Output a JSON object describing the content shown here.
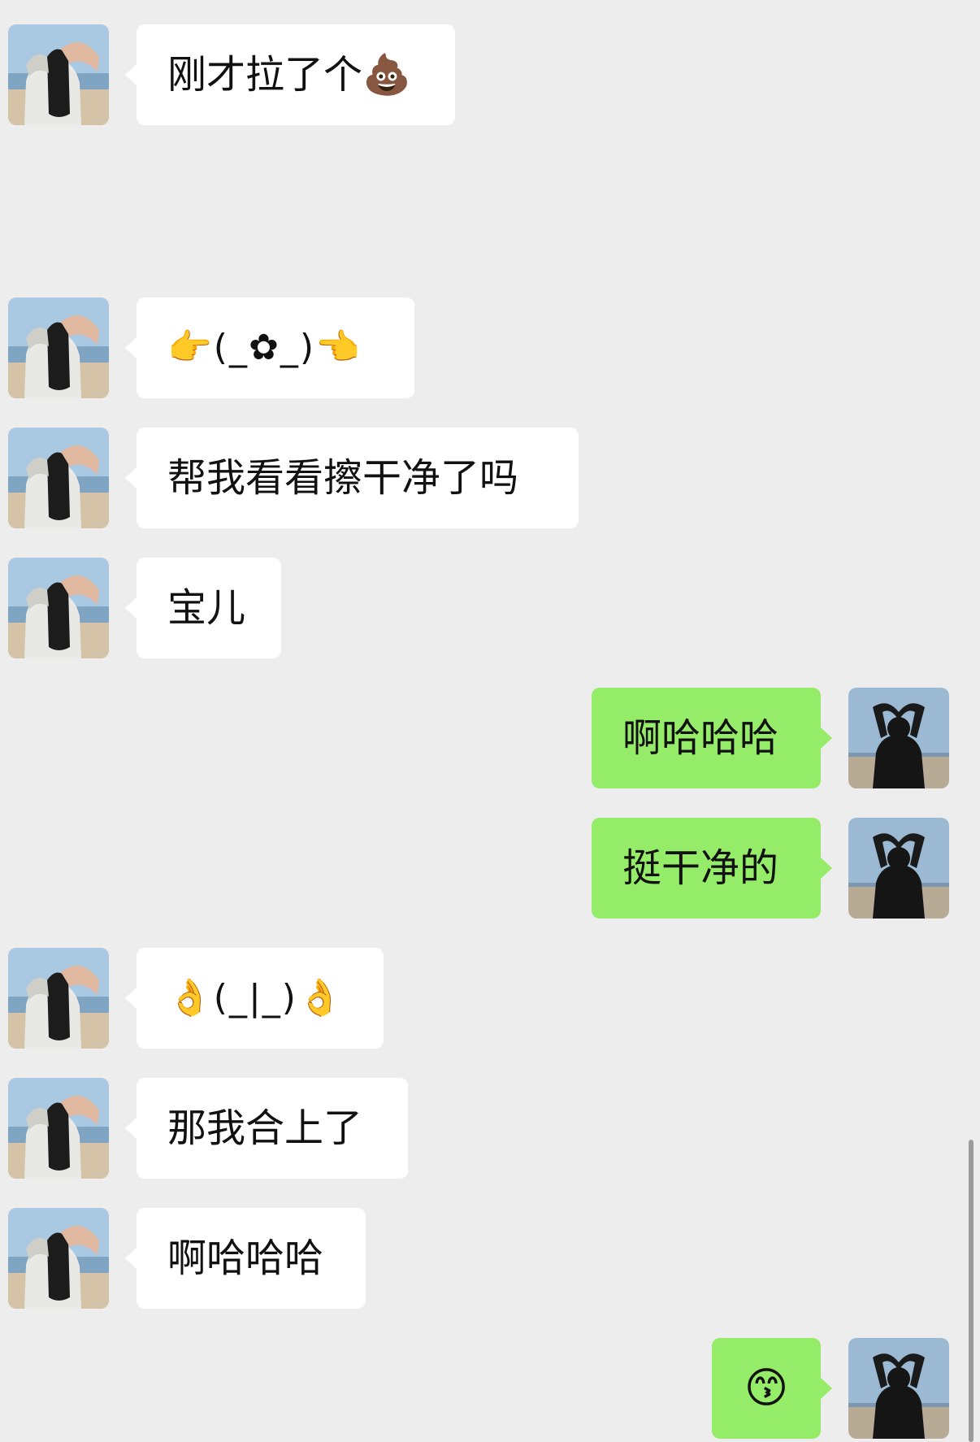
{
  "messages": [
    {
      "side": "left",
      "text": "刚才拉了个💩"
    },
    {
      "side": "left",
      "text": "👉(_✿_)👈"
    },
    {
      "side": "left",
      "text": "帮我看看擦干净了吗"
    },
    {
      "side": "left",
      "text": "宝儿"
    },
    {
      "side": "right",
      "text": "啊哈哈哈"
    },
    {
      "side": "right",
      "text": "挺干净的"
    },
    {
      "side": "left",
      "text": "👌(_|_)👌"
    },
    {
      "side": "left",
      "text": "那我合上了"
    },
    {
      "side": "left",
      "text": "啊哈哈哈"
    },
    {
      "side": "right",
      "text": "😙"
    }
  ]
}
